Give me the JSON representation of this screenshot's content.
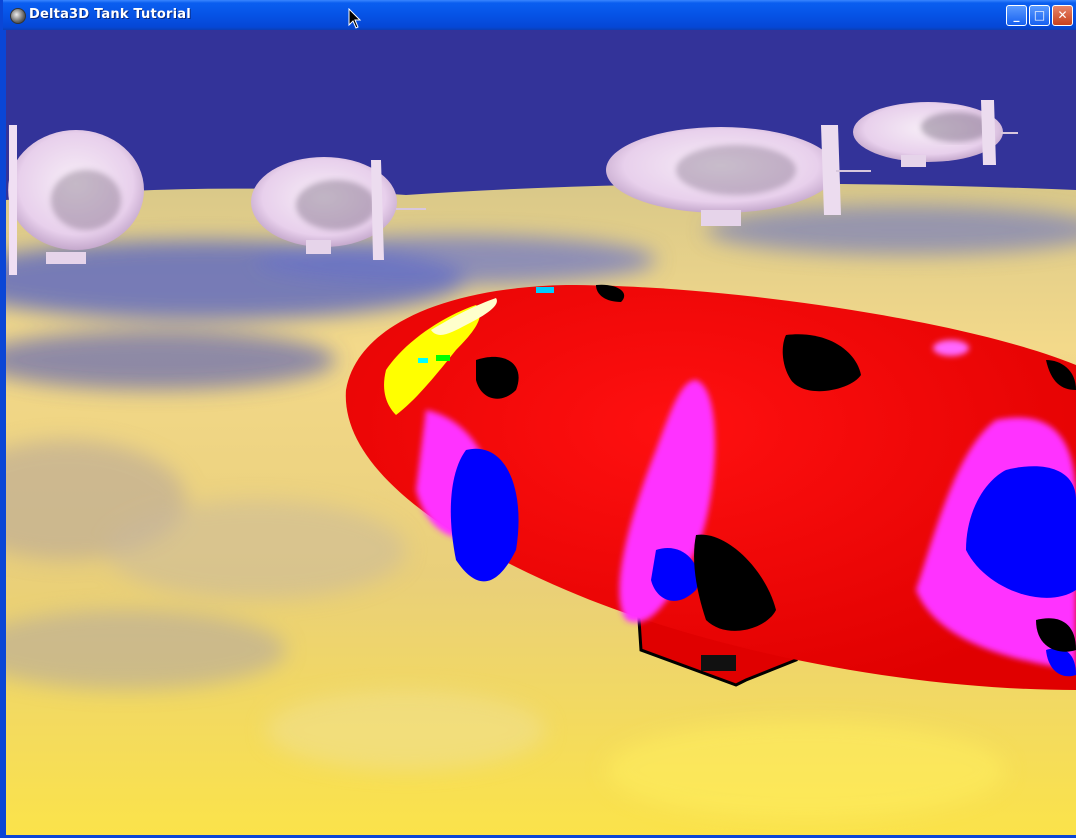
{
  "window": {
    "title": "Delta3D Tank Tutorial",
    "minimize_label": "_",
    "maximize_label": "□",
    "close_label": "✕"
  },
  "scene": {
    "sky_color": "#333399",
    "ground_colors": [
      "#f6d56e",
      "#5b66c0",
      "#fbe24a"
    ],
    "blimp_colors": [
      "#ff0000",
      "#ff00ff",
      "#0000ff",
      "#000000",
      "#ffff00"
    ]
  }
}
